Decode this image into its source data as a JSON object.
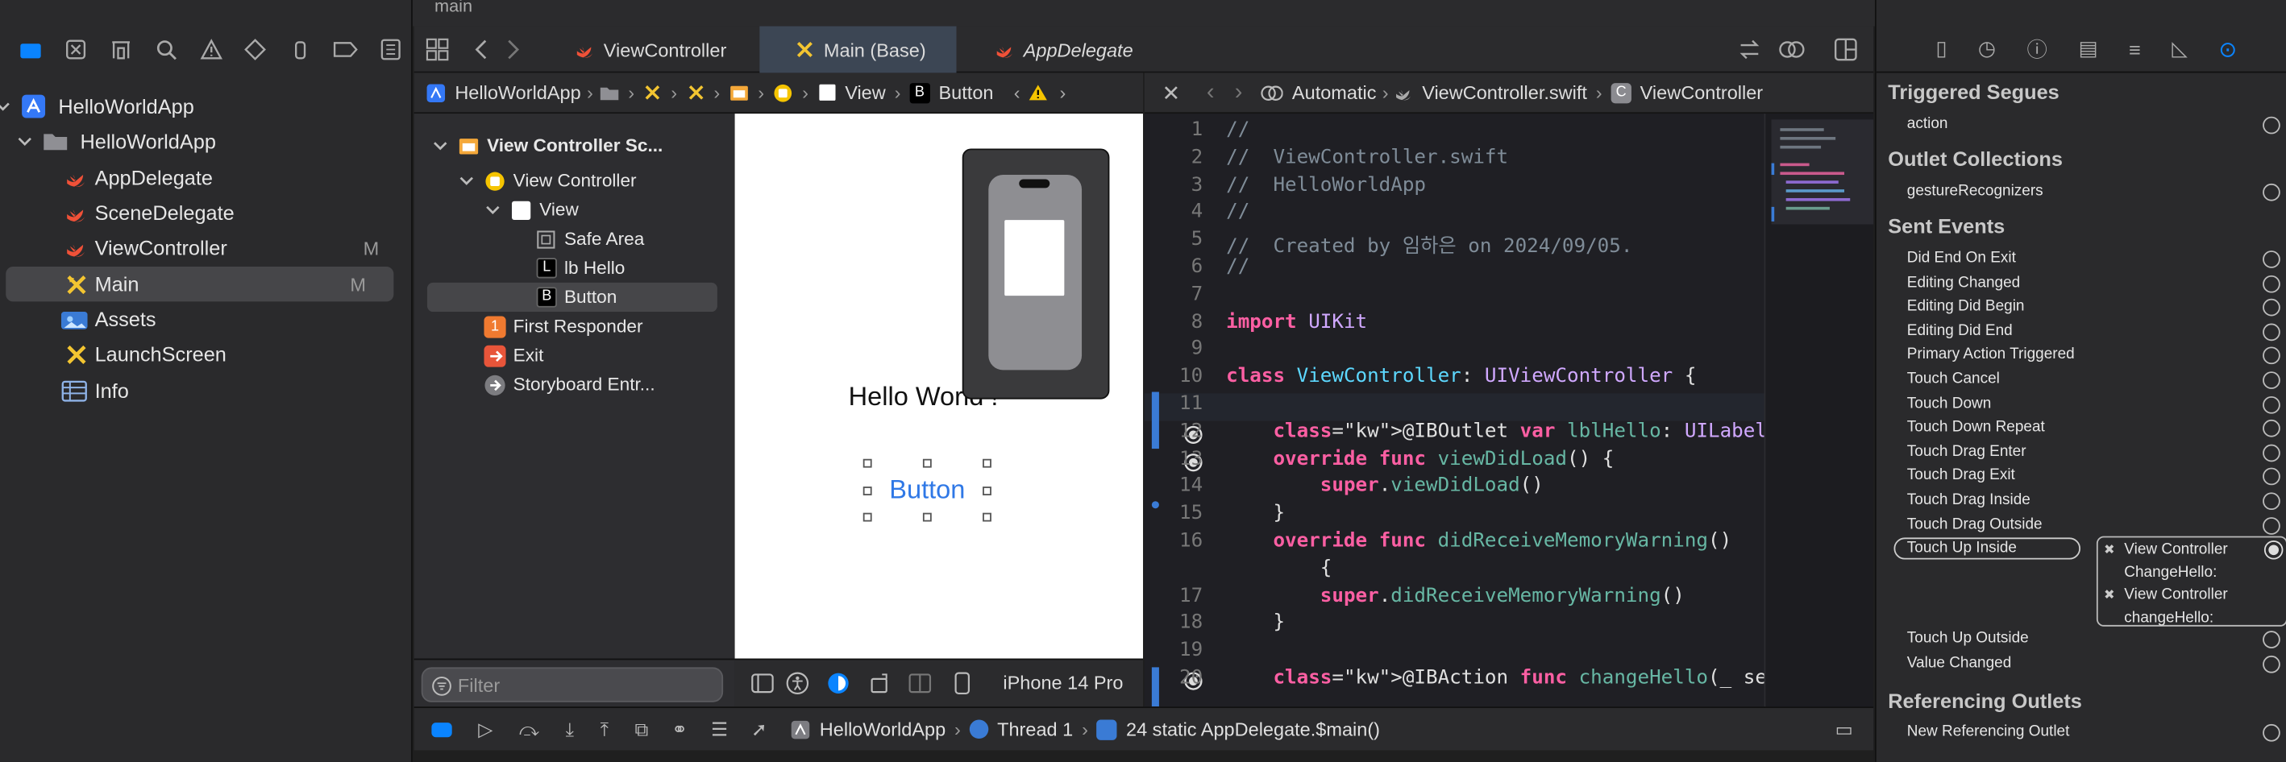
{
  "window": {
    "branch": "main"
  },
  "navigator": {
    "items": [
      {
        "label": "HelloWorldApp",
        "badge": "",
        "icon": "xcode-project-icon"
      },
      {
        "label": "HelloWorldApp",
        "badge": "",
        "icon": "folder-icon"
      },
      {
        "label": "AppDelegate",
        "badge": "",
        "icon": "swift-file-icon"
      },
      {
        "label": "SceneDelegate",
        "badge": "",
        "icon": "swift-file-icon"
      },
      {
        "label": "ViewController",
        "badge": "M",
        "icon": "swift-file-icon"
      },
      {
        "label": "Main",
        "badge": "M",
        "icon": "storyboard-icon"
      },
      {
        "label": "Assets",
        "badge": "",
        "icon": "assets-icon"
      },
      {
        "label": "LaunchScreen",
        "badge": "",
        "icon": "storyboard-icon"
      },
      {
        "label": "Info",
        "badge": "",
        "icon": "plist-table-icon"
      }
    ]
  },
  "tabs": [
    {
      "label": "ViewController",
      "active": false
    },
    {
      "label": "Main (Base)",
      "active": true
    },
    {
      "label": "AppDelegate",
      "active": false
    }
  ],
  "ib_jumpbar": {
    "project": "HelloWorldApp",
    "view": "View",
    "button": "Button"
  },
  "outline": {
    "items": [
      "View Controller Sc...",
      "View Controller",
      "View",
      "Safe Area",
      "lb Hello",
      "Button",
      "First Responder",
      "Exit",
      "Storyboard Entr..."
    ]
  },
  "canvas": {
    "hello_label": "Hello World !",
    "button_label": "Button"
  },
  "ib_bottom": {
    "filter_placeholder": "Filter",
    "device": "iPhone 14 Pro"
  },
  "code_jumpbar": {
    "mode": "Automatic",
    "file": "ViewController.swift",
    "symbol": "ViewController"
  },
  "code": {
    "line_numbers": [
      "1",
      "2",
      "3",
      "4",
      "5",
      "6",
      "7",
      "8",
      "9",
      "10",
      "11",
      "12",
      "13",
      "14",
      "15",
      "16",
      "",
      "17",
      "18",
      "19",
      "20"
    ],
    "lines": [
      "//",
      "//  ViewController.swift",
      "//  HelloWorldApp",
      "//",
      "//  Created by 임하은 on 2024/09/05.",
      "//",
      "",
      "import UIKit",
      "",
      "class ViewController: UIViewController {",
      "",
      "    @IBOutlet var lblHello: UILabel!",
      "    override func viewDidLoad() {",
      "        super.viewDidLoad()",
      "    }",
      "    override func didReceiveMemoryWarning()",
      "        {",
      "        super.didReceiveMemoryWarning()",
      "    }",
      "",
      "    @IBAction func changeHello(_ sender:"
    ]
  },
  "debug": {
    "project": "HelloWorldApp",
    "thread": "Thread 1",
    "frame": "24 static AppDelegate.$main()"
  },
  "inspector": {
    "sections": {
      "triggered_segues": "Triggered Segues",
      "outlet_collections": "Outlet Collections",
      "sent_events": "Sent Events",
      "referencing_outlets": "Referencing Outlets"
    },
    "triggered": [
      "action"
    ],
    "outlet_collections": [
      "gestureRecognizers"
    ],
    "sent_events": [
      "Did End On Exit",
      "Editing Changed",
      "Editing Did Begin",
      "Editing Did End",
      "Primary Action Triggered",
      "Touch Cancel",
      "Touch Down",
      "Touch Down Repeat",
      "Touch Drag Enter",
      "Touch Drag Exit",
      "Touch Drag Inside",
      "Touch Drag Outside",
      "Touch Up Inside",
      "Touch Up Outside",
      "Value Changed"
    ],
    "connections": [
      {
        "line1": "View Controller",
        "line2": "ChangeHello:"
      },
      {
        "line1": "View Controller",
        "line2": "changeHello:"
      }
    ],
    "referencing": [
      "New Referencing Outlet"
    ]
  }
}
